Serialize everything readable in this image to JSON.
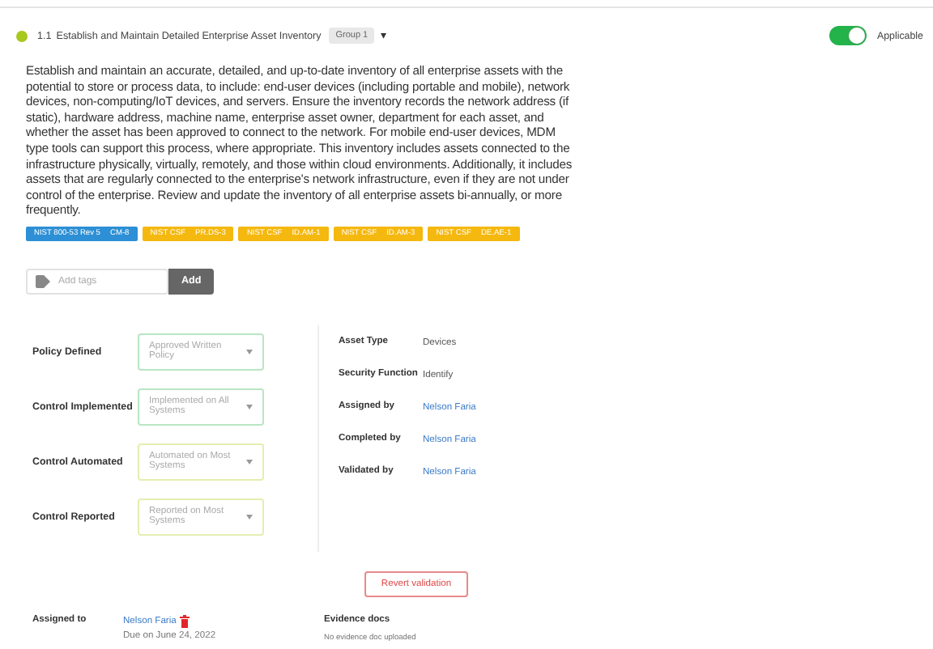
{
  "header": {
    "number": "1.1",
    "title": "Establish and Maintain Detailed Enterprise Asset Inventory",
    "group": "Group 1",
    "caret": "▾",
    "toggle": {
      "on": true,
      "label": "Applicable"
    }
  },
  "description": "Establish and maintain an accurate, detailed, and up-to-date inventory of all enterprise assets with the potential to store or process data, to include: end-user devices (including portable and mobile), network devices, non-computing/IoT devices, and servers. Ensure the inventory records the network address (if static), hardware address, machine name, enterprise asset owner, department for each asset, and whether the asset has been approved to connect to the network. For mobile end-user devices, MDM type tools can support this process, where appropriate. This inventory includes assets connected to the infrastructure physically, virtually, remotely, and those within cloud environments. Additionally, it includes assets that are regularly connected to the enterprise's network infrastructure, even if they are not under control of the enterprise. Review and update the inventory of all enterprise assets bi-annually, or more frequently.",
  "mappings": [
    {
      "framework": "NIST 800-53 Rev 5",
      "control": "CM-8",
      "color": "#2d8fd5"
    },
    {
      "framework": "NIST CSF",
      "control": "PR.DS-3",
      "color": "#f5b80f"
    },
    {
      "framework": "NIST CSF",
      "control": "ID.AM-1",
      "color": "#f5b80f"
    },
    {
      "framework": "NIST CSF",
      "control": "ID.AM-3",
      "color": "#f5b80f"
    },
    {
      "framework": "NIST CSF",
      "control": "DE.AE-1",
      "color": "#f5b80f"
    }
  ],
  "tags": {
    "placeholder": "Add tags",
    "button": "Add"
  },
  "maturity": [
    {
      "label": "Policy Defined",
      "value": "Approved Written Policy",
      "color": "#b9e6c3"
    },
    {
      "label": "Control Implemented",
      "value": "Implemented on All Systems",
      "color": "#b9e6c3"
    },
    {
      "label": "Control Automated",
      "value": "Automated on Most Systems",
      "color": "#e3efb0"
    },
    {
      "label": "Control Reported",
      "value": "Reported on Most Systems",
      "color": "#e3efb0"
    }
  ],
  "details": [
    {
      "label": "Asset Type",
      "value": "Devices",
      "kind": "text"
    },
    {
      "label": "Security Function",
      "value": "Identify",
      "kind": "text"
    },
    {
      "label": "Assigned by",
      "value": "Nelson Faria",
      "kind": "person"
    },
    {
      "label": "Completed by",
      "value": "Nelson Faria",
      "kind": "person"
    },
    {
      "label": "Validated by",
      "value": "Nelson Faria",
      "kind": "person"
    }
  ],
  "revert_button": "Revert validation",
  "assigned_to": {
    "label": "Assigned to",
    "name": "Nelson Faria",
    "due": "Due on June 24, 2022"
  },
  "evidence": {
    "title": "Evidence docs",
    "empty": "No evidence doc uploaded"
  }
}
